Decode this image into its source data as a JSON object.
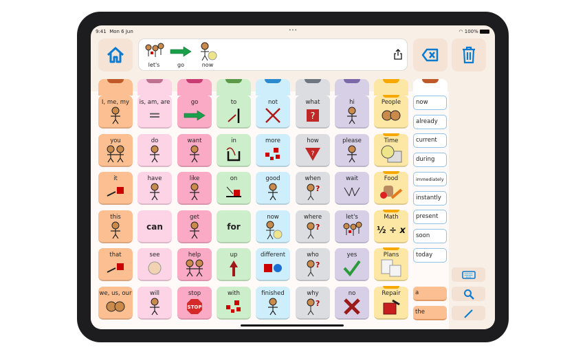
{
  "status": {
    "time": "9:41",
    "date": "Mon 6 Jun",
    "battery": "100%"
  },
  "sentence": [
    {
      "word": "let's",
      "icon": "people-walking"
    },
    {
      "word": "go",
      "icon": "green-arrow"
    },
    {
      "word": "now",
      "icon": "person-clock"
    }
  ],
  "colors": {
    "accent": "#0a7bd0",
    "orange": "#fcbf91",
    "lightpink": "#fdd3e6",
    "pink": "#fbaac6",
    "green": "#cdeeca",
    "blue": "#cdeefa",
    "gray": "#dcdde0",
    "purple": "#d6cfe6",
    "yellow": "#fde7a4"
  },
  "tabs": [
    {
      "bg": "#fcbf91",
      "top": "#c0592a"
    },
    {
      "bg": "#fdd3e6",
      "top": "#c07090"
    },
    {
      "bg": "#fbaac6",
      "top": "#c83b73"
    },
    {
      "bg": "#cdeeca",
      "top": "#5a9a48"
    },
    {
      "bg": "#cdeefa",
      "top": "#2a8ad0"
    },
    {
      "bg": "#dcdde0",
      "top": "#6f7680"
    },
    {
      "bg": "#d6cfe6",
      "top": "#7a68a8"
    },
    {
      "bg": "#fde7a4",
      "top": "#f7a800"
    },
    {
      "bg": "#ffffff",
      "top": "#c0592a"
    }
  ],
  "columns": [
    {
      "color": "#fcbf91",
      "cells": [
        {
          "label": "I, me, my",
          "icon": "person"
        },
        {
          "label": "you",
          "icon": "people"
        },
        {
          "label": "it",
          "icon": "point"
        },
        {
          "label": "this",
          "icon": "person"
        },
        {
          "label": "that",
          "icon": "point"
        },
        {
          "label": "we, us, our",
          "icon": "faces"
        }
      ]
    },
    {
      "color": "#fdd3e6",
      "cells": [
        {
          "label": "is, am, are",
          "icon": "equals"
        },
        {
          "label": "do",
          "icon": "person"
        },
        {
          "label": "have",
          "icon": "person"
        },
        {
          "label": "can",
          "icon": ""
        },
        {
          "label": "see",
          "icon": "face"
        },
        {
          "label": "will",
          "icon": "person"
        }
      ]
    },
    {
      "color": "#fbaac6",
      "cells": [
        {
          "label": "go",
          "icon": "green-arrow"
        },
        {
          "label": "want",
          "icon": "person"
        },
        {
          "label": "like",
          "icon": "person"
        },
        {
          "label": "get",
          "icon": "person"
        },
        {
          "label": "help",
          "icon": "people"
        },
        {
          "label": "stop",
          "icon": "stop-sign"
        }
      ]
    },
    {
      "color": "#cdeeca",
      "cells": [
        {
          "label": "to",
          "icon": "arrow-to"
        },
        {
          "label": "in",
          "icon": "arrow-in"
        },
        {
          "label": "on",
          "icon": "arrow-on"
        },
        {
          "label": "for",
          "icon": ""
        },
        {
          "label": "up",
          "icon": "arrow-up"
        },
        {
          "label": "with",
          "icon": "blocks"
        }
      ]
    },
    {
      "color": "#cdeefa",
      "cells": [
        {
          "label": "not",
          "icon": "cross"
        },
        {
          "label": "more",
          "icon": "blocks"
        },
        {
          "label": "good",
          "icon": "person"
        },
        {
          "label": "now",
          "icon": "person-clock"
        },
        {
          "label": "different",
          "icon": "square-circle"
        },
        {
          "label": "finished",
          "icon": "person"
        }
      ]
    },
    {
      "color": "#dcdde0",
      "cells": [
        {
          "label": "what",
          "icon": "question-box"
        },
        {
          "label": "how",
          "icon": "question-triangle"
        },
        {
          "label": "when",
          "icon": "person-question"
        },
        {
          "label": "where",
          "icon": "person-question"
        },
        {
          "label": "who",
          "icon": "person-question"
        },
        {
          "label": "why",
          "icon": "person-question"
        }
      ]
    },
    {
      "color": "#d6cfe6",
      "cells": [
        {
          "label": "hi",
          "icon": "person"
        },
        {
          "label": "please",
          "icon": "person"
        },
        {
          "label": "wait",
          "icon": "hands"
        },
        {
          "label": "let's",
          "icon": "people-walking"
        },
        {
          "label": "yes",
          "icon": "check"
        },
        {
          "label": "no",
          "icon": "big-cross"
        }
      ]
    },
    {
      "color": "#fde7a4",
      "cells": [
        {
          "label": "People",
          "icon": "faces"
        },
        {
          "label": "Time",
          "icon": "clock-calendar"
        },
        {
          "label": "Food",
          "icon": "food"
        },
        {
          "label": "Math",
          "icon": "math"
        },
        {
          "label": "Plans",
          "icon": "plans"
        },
        {
          "label": "Repair",
          "icon": "toolbox"
        }
      ]
    }
  ],
  "words": [
    "now",
    "already",
    "current",
    "during",
    "immediately",
    "instantly",
    "present",
    "soon",
    "today"
  ],
  "articles": [
    "a",
    "the"
  ],
  "buttons": {
    "home": "home-icon",
    "backspace": "backspace-icon",
    "trash": "trash-icon",
    "keyboard": "keyboard-icon",
    "search": "search-icon",
    "edit": "pencil-icon"
  }
}
